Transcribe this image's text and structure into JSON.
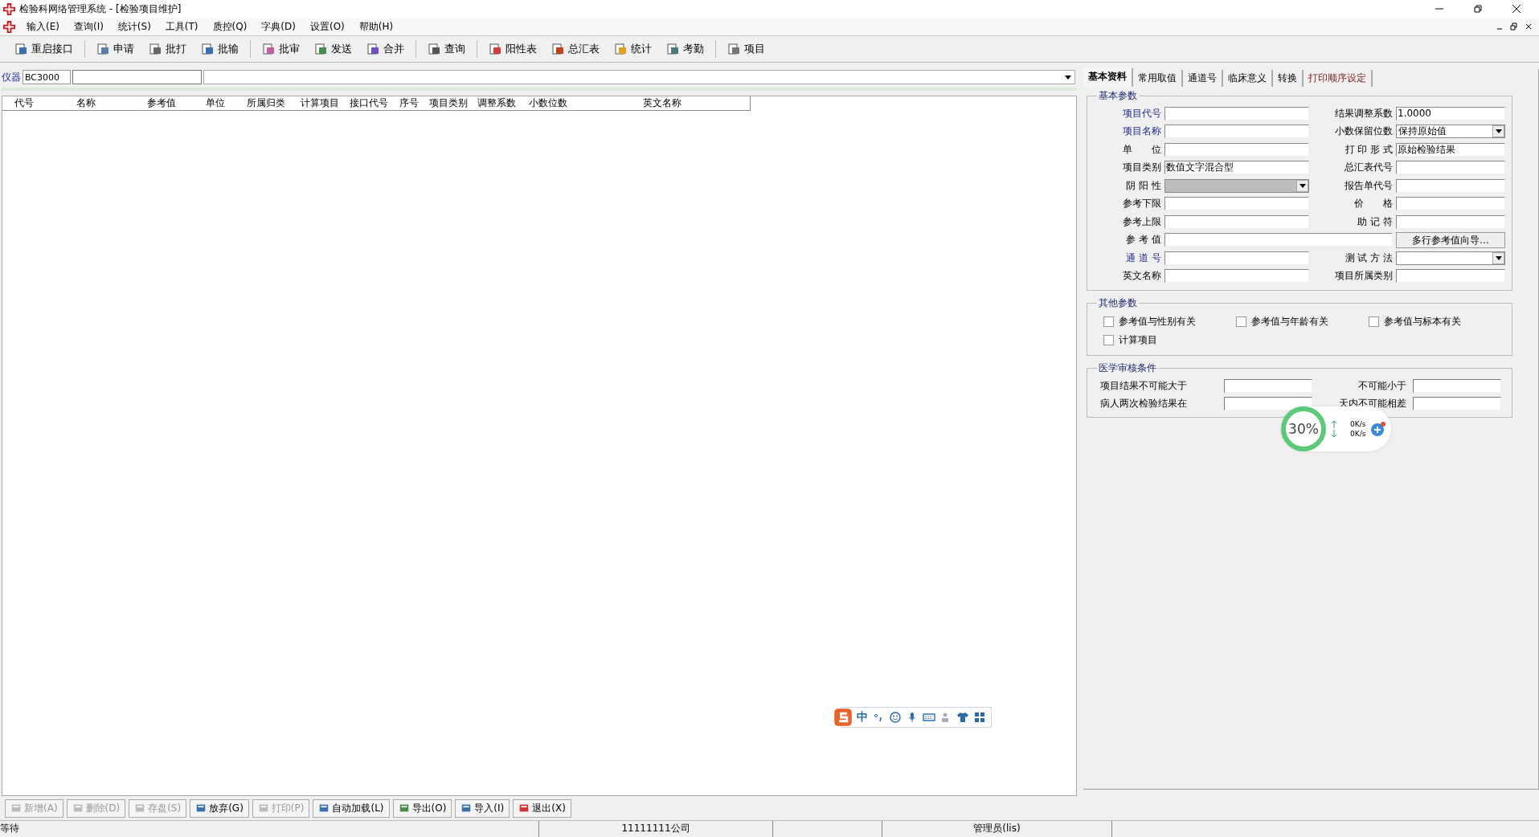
{
  "window": {
    "title": "检验科网络管理系统 - [检验项目维护]"
  },
  "menu": [
    "输入(E)",
    "查询(I)",
    "统计(S)",
    "工具(T)",
    "质控(Q)",
    "字典(D)",
    "设置(O)",
    "帮助(H)"
  ],
  "toolbar": [
    "重启接口",
    "申请",
    "批打",
    "批输",
    "批审",
    "发送",
    "合并",
    "查询",
    "阳性表",
    "总汇表",
    "统计",
    "考勤",
    "项目"
  ],
  "instrument": {
    "label": "仪器",
    "value": "BC3000"
  },
  "table": {
    "columns": [
      "代号",
      "名称",
      "参考值",
      "单位",
      "所属归类",
      "计算项目",
      "接口代号",
      "序号",
      "项目类别",
      "调整系数",
      "小数位数",
      "英文名称"
    ]
  },
  "tabs": [
    {
      "label": "基本资料",
      "selected": true,
      "emphasized": false
    },
    {
      "label": "常用取值",
      "selected": false,
      "emphasized": false
    },
    {
      "label": "通道号",
      "selected": false,
      "emphasized": false
    },
    {
      "label": "临床意义",
      "selected": false,
      "emphasized": false
    },
    {
      "label": "转换",
      "selected": false,
      "emphasized": false
    },
    {
      "label": "打印顺序设定",
      "selected": false,
      "emphasized": true
    }
  ],
  "basic_params": {
    "legend": "基本参数",
    "rows": [
      [
        {
          "kind": "text",
          "label": "项目代号",
          "required": true
        },
        {
          "kind": "text",
          "label": "结果调整系数",
          "required": false,
          "value": "1.0000"
        }
      ],
      [
        {
          "kind": "text",
          "label": "项目名称",
          "required": true
        },
        {
          "kind": "select",
          "label": "小数保留位数",
          "required": false,
          "value": "保持原始值",
          "disabled": false
        }
      ],
      [
        {
          "kind": "text",
          "label": "单　　位",
          "required": false
        },
        {
          "kind": "text",
          "label": "打 印 形 式",
          "required": false,
          "value": "原始检验结果"
        }
      ],
      [
        {
          "kind": "text",
          "label": "项目类别",
          "required": false,
          "value": "数值文字混合型"
        },
        {
          "kind": "text",
          "label": "总汇表代号",
          "required": false
        }
      ],
      [
        {
          "kind": "select",
          "label": "阴 阳 性",
          "required": false,
          "disabled": true
        },
        {
          "kind": "text",
          "label": "报告单代号",
          "required": false
        }
      ],
      [
        {
          "kind": "text",
          "label": "参考下限",
          "required": false
        },
        {
          "kind": "text",
          "label": "价　　格",
          "required": false
        }
      ],
      [
        {
          "kind": "text",
          "label": "参考上限",
          "required": false
        },
        {
          "kind": "text",
          "label": "助 记 符",
          "required": false
        }
      ],
      [
        {
          "kind": "wide",
          "label": "参 考 值",
          "required": false
        },
        {
          "kind": "button",
          "label": "多行参考值向导..."
        }
      ],
      [
        {
          "kind": "text",
          "label": "通 道 号",
          "required": true
        },
        {
          "kind": "select",
          "label": "测 试 方 法",
          "required": false,
          "disabled": false
        }
      ],
      [
        {
          "kind": "text",
          "label": "英文名称",
          "required": false
        },
        {
          "kind": "text",
          "label": "项目所属类别",
          "required": false
        }
      ]
    ]
  },
  "other_params": {
    "legend": "其他参数",
    "options": [
      {
        "label": "参考值与性别有关",
        "checked": false
      },
      {
        "label": "参考值与年龄有关",
        "checked": false
      },
      {
        "label": "参考值与标本有关",
        "checked": false
      },
      {
        "label": "计算项目",
        "checked": false
      }
    ]
  },
  "audit": {
    "legend": "医学审核条件",
    "rows": [
      [
        "项目结果不可能大于",
        "不可能小于"
      ],
      [
        "病人两次检验结果在",
        "天内不可能相差"
      ]
    ]
  },
  "net_monitor": {
    "percent": "30%",
    "up": "0K/s",
    "down": "0K/s"
  },
  "ime_bar": {
    "mode": "中"
  },
  "bottom_buttons": [
    {
      "label": "新增(A)",
      "disabled": true
    },
    {
      "label": "删除(D)",
      "disabled": true
    },
    {
      "label": "存盘(S)",
      "disabled": true
    },
    {
      "label": "放弃(G)",
      "disabled": false
    },
    {
      "label": "打印(P)",
      "disabled": true
    },
    {
      "label": "自动加载(L)",
      "disabled": false
    },
    {
      "label": "导出(O)",
      "disabled": false
    },
    {
      "label": "导入(I)",
      "disabled": false
    },
    {
      "label": "退出(X)",
      "disabled": false
    }
  ],
  "status_bar": [
    "等待",
    "11111111公司",
    "管理员(lis)"
  ]
}
